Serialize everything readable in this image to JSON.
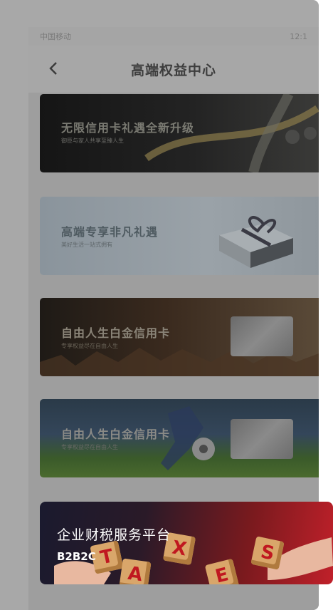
{
  "status_bar": {
    "carrier": "中国移动",
    "right": "12:1"
  },
  "nav": {
    "title": "高端权益中心"
  },
  "banners": [
    {
      "title": "无限信用卡礼遇全新升级",
      "subtitle": "御臣与家人共享至臻人生"
    },
    {
      "title": "高端专享非凡礼遇",
      "subtitle": "美好生活一站式拥有"
    },
    {
      "title": "自由人生白金信用卡",
      "subtitle": "专享权益尽在自由人生"
    },
    {
      "title": "自由人生白金信用卡",
      "subtitle": "专享权益尽在自由人生"
    }
  ],
  "ad": {
    "title": "企业财税服务平台",
    "subtitle": "B2B2C",
    "cube_letters": [
      "T",
      "A",
      "X",
      "E",
      "S"
    ]
  }
}
